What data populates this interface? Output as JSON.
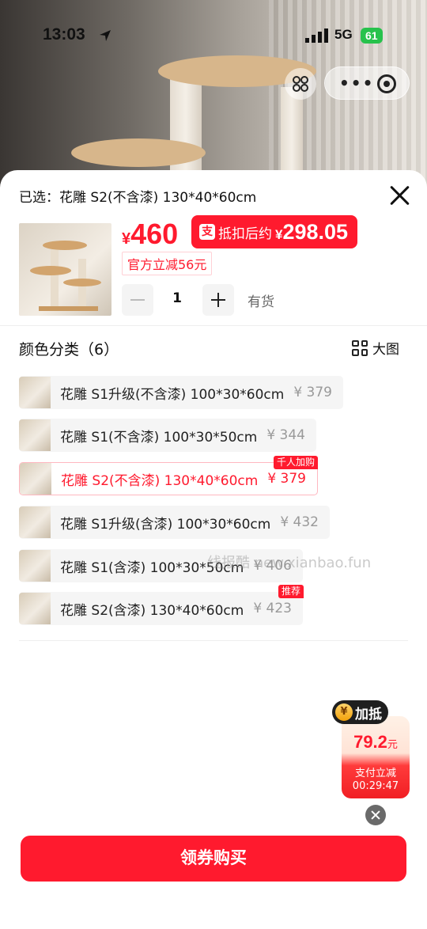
{
  "status_bar": {
    "time": "13:03",
    "network": "5G",
    "battery": "61"
  },
  "selected": {
    "text": "已选：花雕 S2(不含漆) 130*40*60cm"
  },
  "price": {
    "currency": "¥",
    "amount": "460",
    "deal_label": "抵扣后约",
    "deal_currency": "¥",
    "deal_price": "298.05",
    "discount_text": "官方立减56元"
  },
  "quantity": {
    "value": "1",
    "stock": "有货"
  },
  "category": {
    "title": "颜色分类（6）",
    "big_image_label": "大图"
  },
  "options": [
    {
      "name": "花雕 S1升级(不含漆) 100*30*60cm",
      "price": "¥ 379",
      "badge": "",
      "selected": false
    },
    {
      "name": "花雕 S1(不含漆) 100*30*50cm",
      "price": "¥ 344",
      "badge": "",
      "selected": false
    },
    {
      "name": "花雕 S2(不含漆) 130*40*60cm",
      "price": "¥ 379",
      "badge": "千人加购",
      "selected": true
    },
    {
      "name": "花雕 S1升级(含漆) 100*30*60cm",
      "price": "¥ 432",
      "badge": "",
      "selected": false
    },
    {
      "name": "花雕 S1(含漆) 100*30*50cm",
      "price": "¥ 406",
      "badge": "",
      "selected": false
    },
    {
      "name": "花雕 S2(含漆) 130*40*60cm",
      "price": "¥ 423",
      "badge": "推荐",
      "selected": false
    }
  ],
  "watermark": "线报酷 new.xianbao.fun",
  "float_coupon": {
    "head": "加抵",
    "amount": "79.2",
    "unit": "元",
    "label": "支付立减",
    "timer": "00:29:47"
  },
  "buy_button": "领券购买",
  "colors": {
    "accent": "#ff1a2e",
    "muted": "#999999"
  }
}
